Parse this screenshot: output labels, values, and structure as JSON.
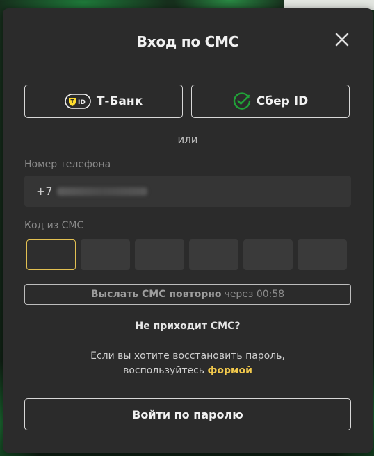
{
  "modal": {
    "title": "Вход по СМС",
    "providers": {
      "tbank": {
        "label": "Т-Банк",
        "badge": "ID"
      },
      "sber": {
        "label": "Сбер ID"
      }
    },
    "divider_text": "или",
    "phone": {
      "label": "Номер телефона",
      "prefix": "+7"
    },
    "code": {
      "label": "Код из СМС",
      "cells": [
        "",
        "",
        "",
        "",
        "",
        ""
      ]
    },
    "resend": {
      "strong": "Выслать СМС повторно",
      "rest": "через 00:58"
    },
    "no_sms": "Не приходит СМС?",
    "recover": {
      "line1": "Если вы хотите восстановить пароль,",
      "line2_prefix": "воспользуйтесь",
      "link": "формой"
    },
    "password_button": "Войти по паролю"
  },
  "colors": {
    "modal_bg": "#2b2b2b",
    "accent_yellow": "#f2c94c",
    "sber_green": "#21a038",
    "tbank_yellow": "#ffdd2d"
  }
}
